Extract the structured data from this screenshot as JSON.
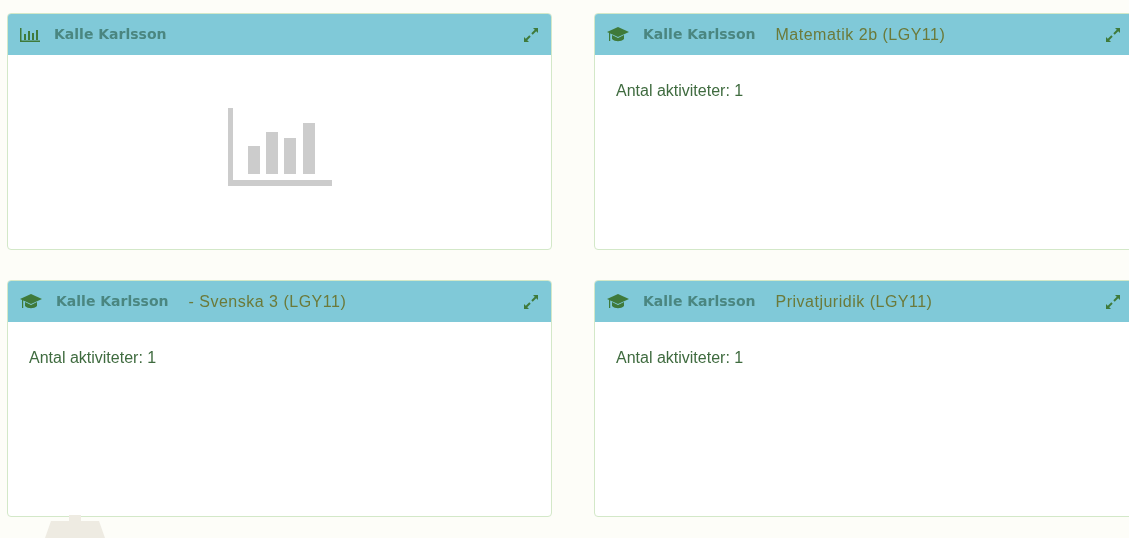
{
  "widgets": [
    {
      "kind": "chart",
      "name": "Kalle Karlsson"
    },
    {
      "kind": "course",
      "name": "Kalle Karlsson",
      "course": "Matematik 2b (LGY11)",
      "body": "Antal aktiviteter: 1"
    },
    {
      "kind": "course",
      "name": "Kalle Karlsson",
      "course": "- Svenska 3 (LGY11)",
      "body": "Antal aktiviteter: 1"
    },
    {
      "kind": "course",
      "name": "Kalle Karlsson",
      "course": "Privatjuridik (LGY11)",
      "body": "Antal aktiviteter: 1"
    }
  ]
}
